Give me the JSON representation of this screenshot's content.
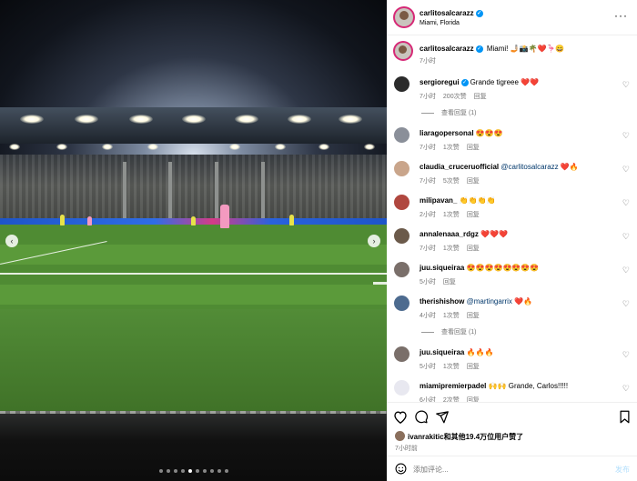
{
  "post": {
    "author": "carlitosalcarazz",
    "location": "Miami, Florida",
    "caption": "Miami! 🤳🏼📸🌴❤️🦩😄",
    "caption_time": "7小时",
    "more_icon": "more-horizontal-icon"
  },
  "photo": {
    "carousel_total": 10,
    "carousel_active": 5,
    "prev_icon": "chevron-left-icon",
    "next_icon": "chevron-right-icon"
  },
  "comments": [
    {
      "user": "sergioregui",
      "verified": true,
      "mention": "",
      "text": "Grande tigreee ❤️❤️",
      "time": "7小时",
      "likes": "200次赞",
      "reply": "回复",
      "replies": "查看回复 (1)",
      "avatar_color": "#2b2b2b"
    },
    {
      "user": "liaragopersonal",
      "verified": false,
      "mention": "",
      "text": "😍😍😍",
      "time": "7小时",
      "likes": "1次赞",
      "reply": "回复",
      "replies": "",
      "avatar_color": "#8a8f99"
    },
    {
      "user": "claudia_cruceruofficial",
      "verified": false,
      "mention": "@carlitosalcarazz",
      "text": "❤️🔥",
      "time": "7小时",
      "likes": "5次赞",
      "reply": "回复",
      "replies": "",
      "avatar_color": "#c9a58b"
    },
    {
      "user": "milipavan_",
      "verified": false,
      "mention": "",
      "text": "👏👏👏👏",
      "time": "2小时",
      "likes": "1次赞",
      "reply": "回复",
      "replies": "",
      "avatar_color": "#b0473f"
    },
    {
      "user": "annalenaaa_rdgz",
      "verified": false,
      "mention": "",
      "text": "❤️❤️❤️",
      "time": "7小时",
      "likes": "1次赞",
      "reply": "回复",
      "replies": "",
      "avatar_color": "#6b5a4a"
    },
    {
      "user": "juu.siqueiraa",
      "verified": false,
      "mention": "",
      "text": "😍😍😍😍😍😍😍😍",
      "time": "5小时",
      "likes": "",
      "reply": "回复",
      "replies": "",
      "avatar_color": "#7a6f6a"
    },
    {
      "user": "therishishow",
      "verified": false,
      "mention": "@martingarrix",
      "text": "❤️🔥",
      "time": "4小时",
      "likes": "1次赞",
      "reply": "回复",
      "replies": "查看回复 (1)",
      "avatar_color": "#4d6b8f"
    },
    {
      "user": "juu.siqueiraa",
      "verified": false,
      "mention": "",
      "text": "🔥🔥🔥",
      "time": "5小时",
      "likes": "1次赞",
      "reply": "回复",
      "replies": "",
      "avatar_color": "#7a6f6a"
    },
    {
      "user": "miamipremierpadel",
      "verified": false,
      "mention": "",
      "text": "🙌🙌 Grande, Carlos!!!!!",
      "time": "6小时",
      "likes": "2次赞",
      "reply": "回复",
      "replies": "",
      "avatar_color": "#e8e8f0"
    }
  ],
  "actions": {
    "like_icon": "heart-icon",
    "comment_icon": "comment-icon",
    "share_icon": "send-icon",
    "save_icon": "bookmark-icon",
    "liked_by": "ivanrakitic和其他19.4万位用户赞了",
    "time": "7小时前"
  },
  "add_comment": {
    "emoji_icon": "emoji-icon",
    "placeholder": "添加评论...",
    "post_label": "发布"
  },
  "colors": {
    "accent": "#0095f6",
    "heart_red": "#ed4956",
    "muted": "#737373"
  }
}
